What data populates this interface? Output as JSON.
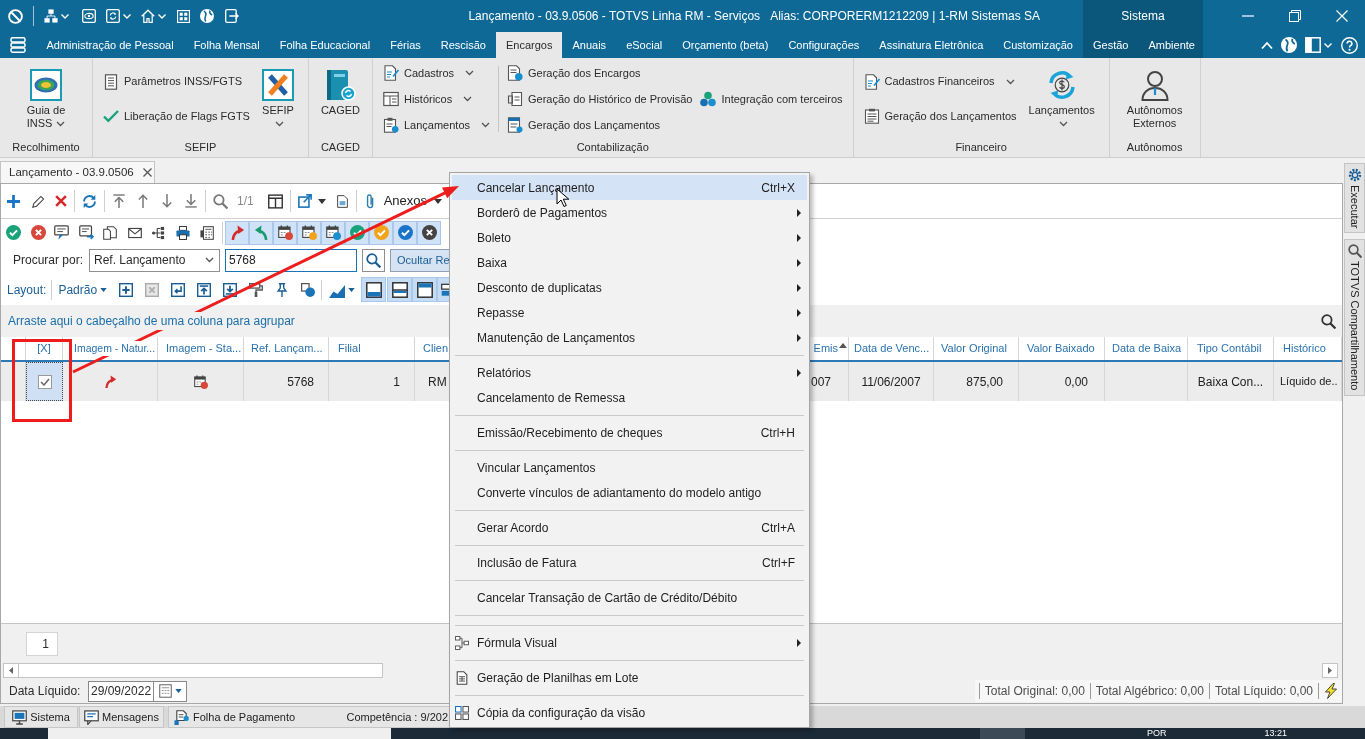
{
  "window": {
    "title": "Lançamento - 03.9.0506 - TOTVS Linha RM - Serviços",
    "alias": "Alias: CORPORERM1212209 | 1-RM Sistemas SA"
  },
  "menu": {
    "tabs": [
      {
        "label": "Administração de Pessoal",
        "selected": false
      },
      {
        "label": "Folha Mensal",
        "selected": false
      },
      {
        "label": "Folha Educacional",
        "selected": false
      },
      {
        "label": "Férias",
        "selected": false
      },
      {
        "label": "Rescisão",
        "selected": false
      },
      {
        "label": "Encargos",
        "selected": true
      },
      {
        "label": "Anuais",
        "selected": false
      },
      {
        "label": "eSocial",
        "selected": false
      },
      {
        "label": "Orçamento (beta)",
        "selected": false
      },
      {
        "label": "Configurações",
        "selected": false
      },
      {
        "label": "Assinatura Eletrônica",
        "selected": false
      },
      {
        "label": "Customização",
        "selected": false
      }
    ],
    "system": {
      "label": "Sistema",
      "tabs": [
        {
          "label": "Gestão",
          "selected": false
        },
        {
          "label": "Ambiente",
          "selected": false
        }
      ]
    }
  },
  "ribbon": [
    {
      "label": "Recolhimento",
      "columns": [
        {
          "kind": "large",
          "label": "Guia de INSS",
          "dropdown": true
        }
      ]
    },
    {
      "label": "SEFIP",
      "columns": [
        {
          "kind": "stack",
          "items": [
            {
              "label": "Parâmetros INSS/FGTS",
              "dropdown": false
            },
            {
              "label": "Liberação de Flags FGTS",
              "dropdown": false
            }
          ]
        },
        {
          "kind": "large",
          "label": "SEFIP",
          "dropdown": true
        }
      ]
    },
    {
      "label": "CAGED",
      "columns": [
        {
          "kind": "large",
          "label": "CAGED",
          "dropdown": false
        }
      ]
    },
    {
      "label": "Contabilização",
      "columns": [
        {
          "kind": "stack",
          "items": [
            {
              "label": "Cadastros",
              "dropdown": true
            },
            {
              "label": "Históricos",
              "dropdown": true
            },
            {
              "label": "Lançamentos",
              "dropdown": true
            }
          ]
        },
        {
          "kind": "separator"
        },
        {
          "kind": "stack",
          "items": [
            {
              "label": "Geração dos Encargos",
              "dropdown": false
            },
            {
              "label": "Geração do Histórico de Provisão",
              "dropdown": false
            },
            {
              "label": "Geração dos Lançamentos",
              "dropdown": false
            }
          ]
        },
        {
          "kind": "stack",
          "items": [
            {
              "label": "Integração com terceiros",
              "dropdown": false
            }
          ]
        }
      ]
    },
    {
      "label": "Financeiro",
      "columns": [
        {
          "kind": "stack",
          "items": [
            {
              "label": "Cadastros Financeiros",
              "dropdown": true
            },
            {
              "label": "Geração dos Lançamentos",
              "dropdown": false
            }
          ]
        },
        {
          "kind": "large",
          "label": "Lançamentos",
          "dropdown": true
        }
      ]
    },
    {
      "label": "Autônomos",
      "columns": [
        {
          "kind": "large",
          "label": "Autônomos Externos",
          "dropdown": false
        }
      ]
    }
  ],
  "document_tab": {
    "label": "Lançamento - 03.9.0506"
  },
  "toolbar": {
    "record_counter": "1/1",
    "attachments": "Anexos"
  },
  "search": {
    "label": "Procurar por:",
    "field": "Ref. Lançamento",
    "value": "5768",
    "hide_button": "Ocultar Re"
  },
  "layout": {
    "label": "Layout:",
    "preset": "Padrão"
  },
  "group_hint": "Arraste aqui o cabeçalho de uma coluna para agrupar",
  "grid": {
    "columns": [
      {
        "label": "[X]"
      },
      {
        "label": "Imagem - Natur..."
      },
      {
        "label": "Imagem - Sta..."
      },
      {
        "label": "Ref. Lançam..."
      },
      {
        "label": "Filial"
      },
      {
        "label": "Clien"
      },
      {
        "label": "Emis",
        "sorted": true
      },
      {
        "label": "Data de Venc..."
      },
      {
        "label": "Valor Original"
      },
      {
        "label": "Valor Baixado"
      },
      {
        "label": "Data de Baixa"
      },
      {
        "label": "Tipo Contábil"
      },
      {
        "label": "Histórico"
      }
    ],
    "rows": [
      {
        "selected": true,
        "checked": true,
        "cells": [
          "",
          "",
          "",
          "5768",
          "1",
          "RM",
          "007",
          "11/06/2007",
          "875,00",
          "0,00",
          "",
          "Baixa Con...",
          "Líquido de.."
        ]
      }
    ]
  },
  "footer": {
    "page": "1",
    "date_label": "Data Líquido:",
    "date_value": "29/09/2022",
    "totals": [
      "Total Original: 0,00",
      "Total Algébrico: 0,00",
      "Total Líquido: 0,00"
    ]
  },
  "side_tabs": [
    "Executar",
    "TOTVS Compartilhamento"
  ],
  "status_bar": {
    "tabs": [
      "Sistema",
      "Mensagens",
      "Folha de Pagamento"
    ],
    "competence": "Competência : 9/202"
  },
  "context_menu": [
    {
      "kind": "item",
      "label": "Cancelar Lançamento",
      "shortcut": "Ctrl+X",
      "submenu": false,
      "selected": true
    },
    {
      "kind": "item",
      "label": "Borderô de Pagamentos",
      "submenu": true,
      "selected": false
    },
    {
      "kind": "item",
      "label": "Boleto",
      "submenu": true,
      "selected": false
    },
    {
      "kind": "item",
      "label": "Baixa",
      "submenu": true,
      "selected": false
    },
    {
      "kind": "item",
      "label": "Desconto de duplicatas",
      "submenu": true,
      "selected": false
    },
    {
      "kind": "item",
      "label": "Repasse",
      "submenu": true,
      "selected": false
    },
    {
      "kind": "item",
      "label": "Manutenção de Lançamentos",
      "submenu": true,
      "selected": false
    },
    {
      "kind": "separator"
    },
    {
      "kind": "item",
      "label": "Relatórios",
      "submenu": true,
      "selected": false
    },
    {
      "kind": "item",
      "label": "Cancelamento de Remessa",
      "submenu": false,
      "selected": false
    },
    {
      "kind": "separator"
    },
    {
      "kind": "item",
      "label": "Emissão/Recebimento de cheques",
      "shortcut": "Ctrl+H",
      "submenu": false,
      "selected": false
    },
    {
      "kind": "separator"
    },
    {
      "kind": "item",
      "label": "Vincular Lançamentos",
      "submenu": false,
      "selected": false
    },
    {
      "kind": "item",
      "label": "Converte vínculos de adiantamento do modelo antigo",
      "submenu": false,
      "selected": false
    },
    {
      "kind": "separator"
    },
    {
      "kind": "item",
      "label": "Gerar Acordo",
      "shortcut": "Ctrl+A",
      "submenu": false,
      "selected": false
    },
    {
      "kind": "separator"
    },
    {
      "kind": "item",
      "label": "Inclusão de Fatura",
      "shortcut": "Ctrl+F",
      "submenu": false,
      "selected": false
    },
    {
      "kind": "separator"
    },
    {
      "kind": "item",
      "label": "Cancelar Transação de Cartão de Crédito/Débito",
      "submenu": false,
      "selected": false
    },
    {
      "kind": "separator"
    },
    {
      "kind": "separator"
    },
    {
      "kind": "item",
      "label": "Fórmula Visual",
      "submenu": true,
      "selected": false
    },
    {
      "kind": "separator"
    },
    {
      "kind": "item",
      "label": "Geração de Planilhas em Lote",
      "submenu": false,
      "selected": false
    },
    {
      "kind": "separator"
    },
    {
      "kind": "item",
      "label": "Cópia da configuração da visão",
      "submenu": false,
      "selected": false
    }
  ],
  "taskbar": {
    "language": "POR",
    "time": "13:21"
  }
}
